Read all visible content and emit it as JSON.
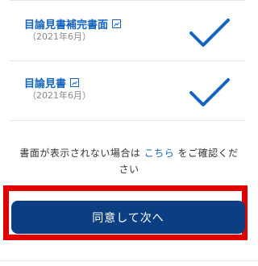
{
  "documents": [
    {
      "title": "目論見書補完書面",
      "date": "（2021年6月）",
      "icon": "pdf-icon",
      "status_icon": "check-icon"
    },
    {
      "title": "目論見書",
      "date": "（2021年6月）",
      "icon": "pdf-icon",
      "status_icon": "check-icon"
    }
  ],
  "notice": {
    "before": "書面が表示されない場合は ",
    "link": "こちら",
    "after": " をご確認ください"
  },
  "agree_button": "同意して次へ",
  "colors": {
    "link": "#1565c0",
    "check": "#1565c0",
    "button": "#0c3f81",
    "highlight": "#e00000"
  }
}
